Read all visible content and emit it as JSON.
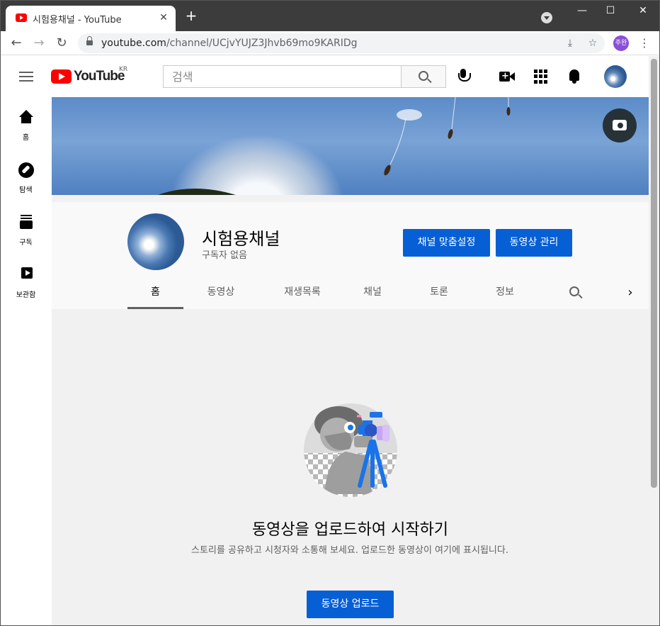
{
  "browser": {
    "tab_title": "시험용채널 - YouTube",
    "tab_close": "✕",
    "new_tab": "+",
    "win_minimize": "—",
    "win_maximize": "☐",
    "win_close": "✕",
    "nav_back": "←",
    "nav_forward": "→",
    "nav_reload": "↻",
    "url_host": "youtube.com",
    "url_path": "/channel/UCjvYUJZ3Jhvb69mo9KARIDg",
    "profile_label": "주완",
    "menu": "⋮",
    "install_icon": "⤓",
    "bookmark_icon": "☆"
  },
  "header": {
    "logo_text": "YouTube",
    "country_code": "KR",
    "search_placeholder": "검색"
  },
  "guide": {
    "items": [
      {
        "label": "홈",
        "icon": "home-icon"
      },
      {
        "label": "탐색",
        "icon": "explore-icon"
      },
      {
        "label": "구독",
        "icon": "subscriptions-icon"
      },
      {
        "label": "보관함",
        "icon": "library-icon"
      }
    ]
  },
  "channel": {
    "name": "시험용채널",
    "subscribers": "구독자 없음",
    "customize_button": "채널 맞춤설정",
    "manage_button": "동영상 관리",
    "tabs": [
      "홈",
      "동영상",
      "재생목록",
      "채널",
      "토론",
      "정보"
    ],
    "next_arrow": "›"
  },
  "empty_state": {
    "title": "동영상을 업로드하여 시작하기",
    "description": "스토리를 공유하고 시청자와 소통해 보세요. 업로드한 동영상이 여기에 표시됩니다.",
    "upload_button": "동영상 업로드"
  },
  "colors": {
    "accent_blue": "#065fd4",
    "youtube_red": "#ff0000",
    "chrome_frame": "#3c3c3c"
  }
}
